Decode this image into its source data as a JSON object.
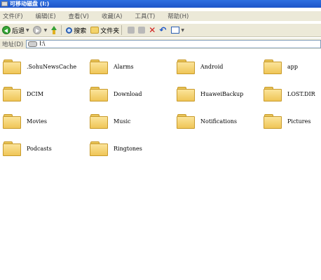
{
  "window": {
    "title": "可移动磁盘 (I:)"
  },
  "menu": [
    "文件(F)",
    "编辑(E)",
    "查看(V)",
    "收藏(A)",
    "工具(T)",
    "帮助(H)"
  ],
  "toolbar": {
    "back_label": "后退",
    "search_label": "搜索",
    "folders_label": "文件夹"
  },
  "address": {
    "label": "地址(D)",
    "value": "I:\\"
  },
  "files": [
    ".SohuNewsCache",
    "Alarms",
    "Android",
    "app",
    "DCIM",
    "Download",
    "HuaweiBackup",
    "LOST.DIR",
    "Movies",
    "Music",
    "Notifications",
    "Pictures",
    "Podcasts",
    "Ringtones"
  ],
  "colors": {
    "titlebar": "#1d55c9",
    "chrome": "#ece9d8",
    "folder": "#efc557"
  }
}
